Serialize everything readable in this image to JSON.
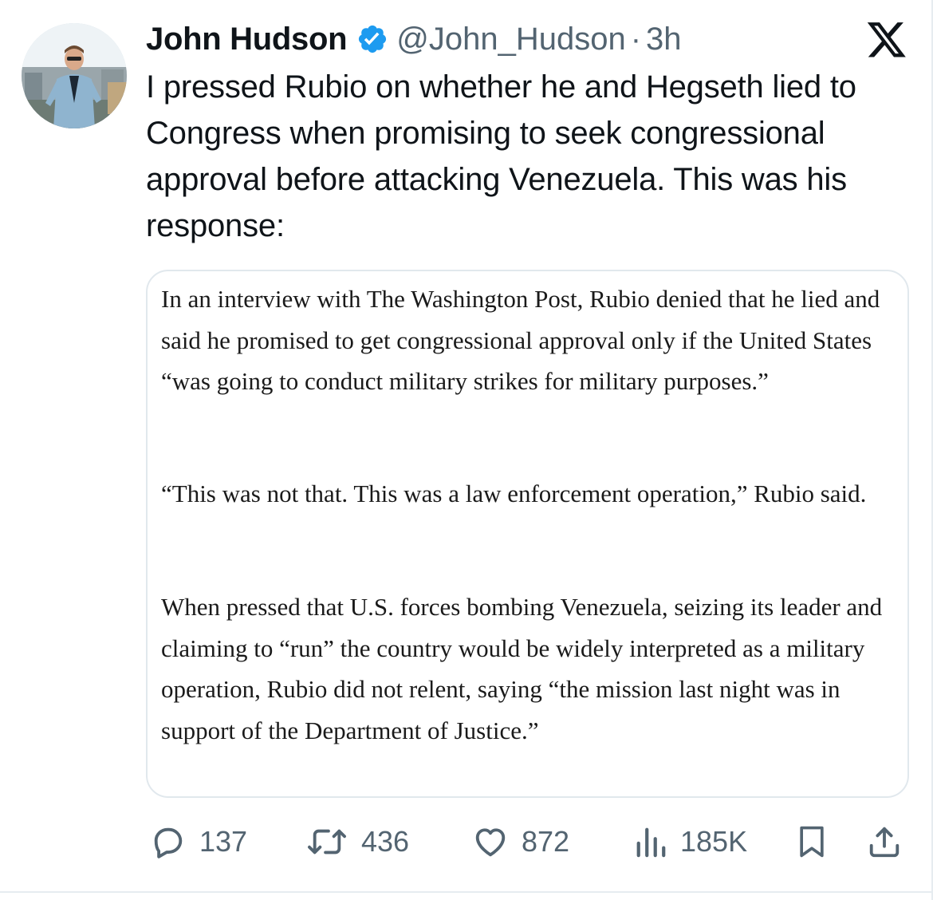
{
  "colors": {
    "text_primary": "#0f1419",
    "text_secondary": "#536471",
    "verified_blue": "#1d9bf0",
    "card_border": "#e1e8ed"
  },
  "author": {
    "display_name": "John Hudson",
    "handle": "@John_Hudson",
    "separator": "·",
    "time": "3h",
    "avatar_icon": "profile-photo",
    "verified_icon": "verified-badge-icon"
  },
  "tweet": {
    "text": "I pressed Rubio on whether he and Hegseth lied to Congress when promising to seek congressional approval before attacking Venezuela. This was his response:"
  },
  "quote_image": {
    "paragraphs": [
      "In an interview with The Washington Post, Rubio denied that he lied and said he promised to get congressional approval only if the United States “was going to conduct military strikes for military purposes.”",
      "“This was not that. This was a law enforcement operation,” Rubio said.",
      "When pressed that U.S. forces bombing Venezuela, seizing its leader and claiming to “run” the country would be widely interpreted as a military operation, Rubio did not relent, saying “the mission last night was in support of the Department of Justice.”"
    ]
  },
  "actions": {
    "replies": "137",
    "reposts": "436",
    "likes": "872",
    "views": "185K",
    "icons": [
      "reply-icon",
      "repost-icon",
      "like-icon",
      "views-icon",
      "bookmark-icon",
      "share-icon"
    ]
  },
  "branding": {
    "logo_icon": "x-logo-icon"
  }
}
